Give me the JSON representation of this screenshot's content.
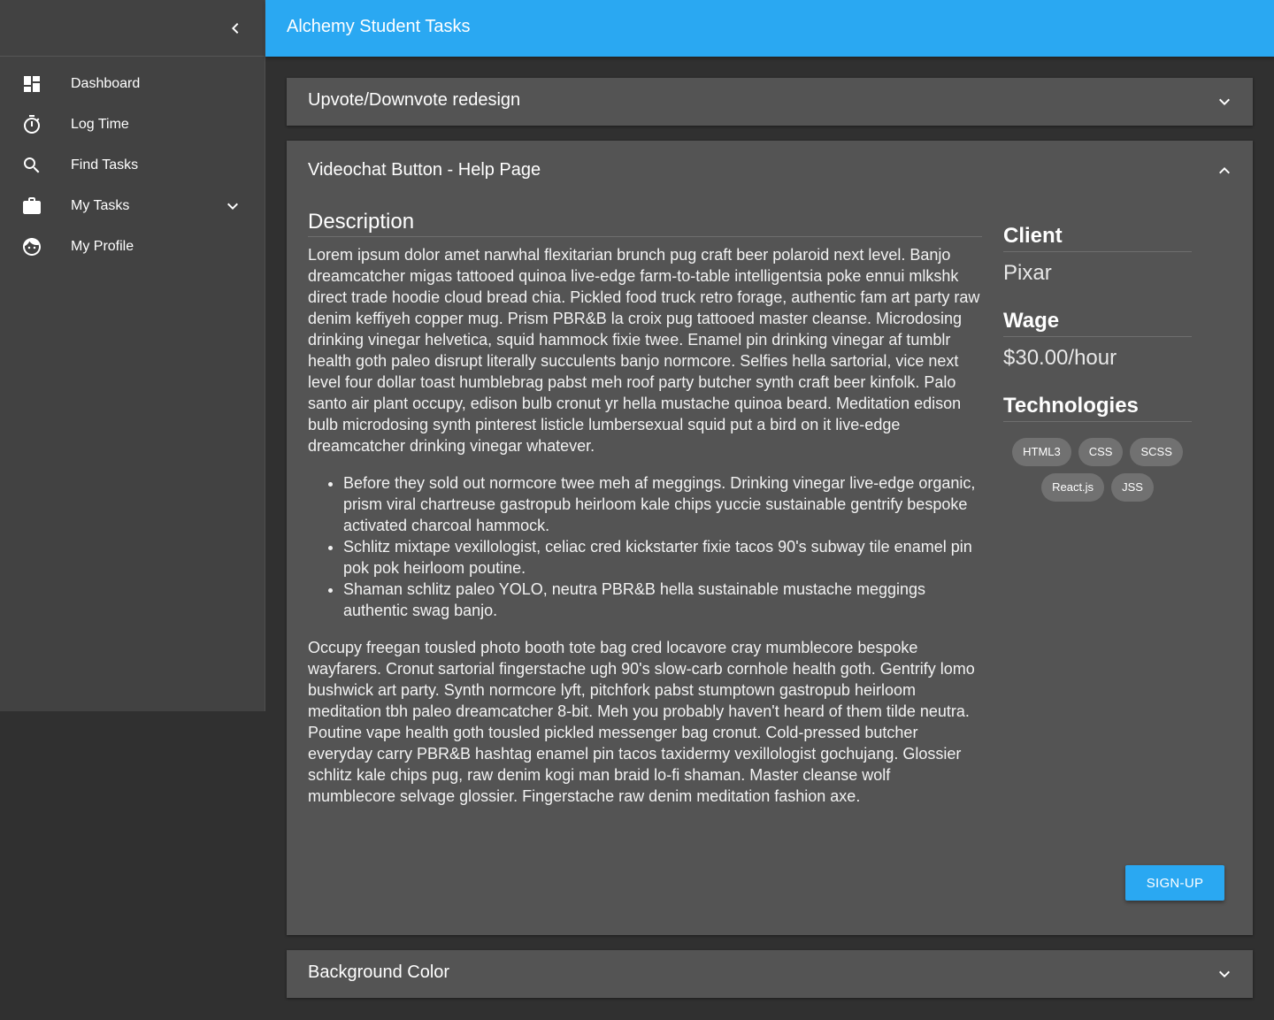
{
  "app": {
    "title": "Alchemy Student Tasks",
    "accent_color": "#2aa8f2"
  },
  "sidebar": {
    "collapse_icon": "chevron-left-icon",
    "items": [
      {
        "label": "Dashboard",
        "icon": "dashboard-icon"
      },
      {
        "label": "Log Time",
        "icon": "timer-icon"
      },
      {
        "label": "Find Tasks",
        "icon": "search-icon"
      },
      {
        "label": "My Tasks",
        "icon": "briefcase-icon",
        "expandable": true
      },
      {
        "label": "My Profile",
        "icon": "face-icon"
      }
    ]
  },
  "panels": [
    {
      "title": "Upvote/Downvote redesign",
      "expanded": false
    },
    {
      "title": "Videochat Button - Help Page",
      "expanded": true,
      "description_heading": "Description",
      "paragraph1": "Lorem ipsum dolor amet narwhal flexitarian brunch pug craft beer polaroid next level. Banjo dreamcatcher migas tattooed quinoa live-edge farm-to-table intelligentsia poke ennui mlkshk direct trade hoodie cloud bread chia. Pickled food truck retro forage, authentic fam art party raw denim keffiyeh copper mug. Prism PBR&B la croix pug tattooed master cleanse. Microdosing drinking vinegar helvetica, squid hammock fixie twee. Enamel pin drinking vinegar af tumblr health goth paleo disrupt literally succulents banjo normcore. Selfies hella sartorial, vice next level four dollar toast humblebrag pabst meh roof party butcher synth craft beer kinfolk. Palo santo air plant occupy, edison bulb cronut yr hella mustache quinoa beard. Meditation edison bulb microdosing synth pinterest listicle lumbersexual squid put a bird on it live-edge dreamcatcher drinking vinegar whatever.",
      "bullets": [
        "Before they sold out normcore twee meh af meggings. Drinking vinegar live-edge organic, prism viral chartreuse gastropub heirloom kale chips yuccie sustainable gentrify bespoke activated charcoal hammock.",
        "Schlitz mixtape vexillologist, celiac cred kickstarter fixie tacos 90's subway tile enamel pin pok pok heirloom poutine.",
        "Shaman schlitz paleo YOLO, neutra PBR&B hella sustainable mustache meggings authentic swag banjo."
      ],
      "paragraph2": "Occupy freegan tousled photo booth tote bag cred locavore cray mumblecore bespoke wayfarers. Cronut sartorial fingerstache ugh 90's slow-carb cornhole health goth. Gentrify lomo bushwick art party. Synth normcore lyft, pitchfork pabst stumptown gastropub heirloom meditation tbh paleo dreamcatcher 8-bit. Meh you probably haven't heard of them tilde neutra. Poutine vape health goth tousled pickled messenger bag cronut. Cold-pressed butcher everyday carry PBR&B hashtag enamel pin tacos taxidermy vexillologist gochujang. Glossier schlitz kale chips pug, raw denim kogi man braid lo-fi shaman. Master cleanse wolf mumblecore selvage glossier. Fingerstache raw denim meditation fashion axe.",
      "client_label": "Client",
      "client_value": "Pixar",
      "wage_label": "Wage",
      "wage_value": "$30.00/hour",
      "tech_label": "Technologies",
      "technologies": [
        "HTML3",
        "CSS",
        "SCSS",
        "React.js",
        "JSS"
      ],
      "signup_label": "SIGN-UP"
    },
    {
      "title": "Background Color",
      "expanded": false
    }
  ]
}
